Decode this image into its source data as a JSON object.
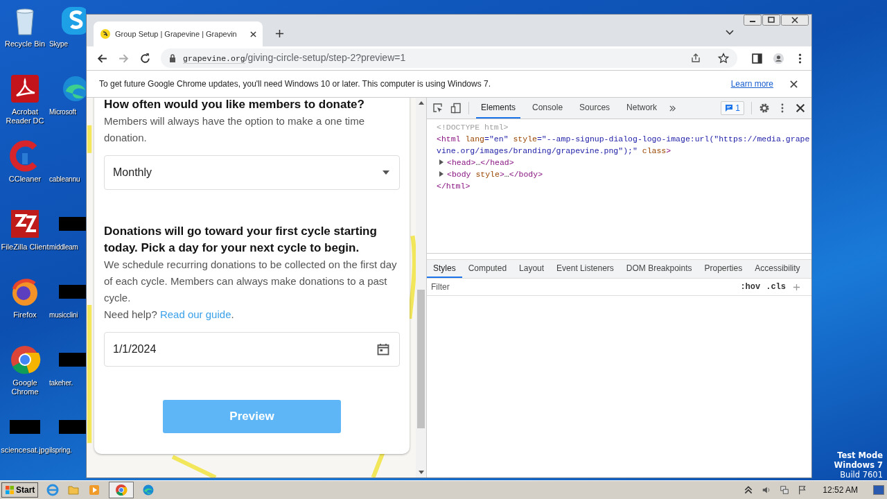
{
  "desktop": {
    "icons": [
      {
        "label": "Recycle Bin",
        "kind": "bin"
      },
      {
        "label": "Skype",
        "kind": "skype"
      },
      {
        "label": "Acrobat Reader DC",
        "kind": "acrobat"
      },
      {
        "label": "Microsoft",
        "kind": "edge"
      },
      {
        "label": "CCleaner",
        "kind": "ccleaner"
      },
      {
        "label": "cableannu",
        "kind": "blank"
      },
      {
        "label": "FileZilla Client",
        "kind": "filezilla"
      },
      {
        "label": "middleam",
        "kind": "file"
      },
      {
        "label": "Firefox",
        "kind": "firefox"
      },
      {
        "label": "musicclini",
        "kind": "file"
      },
      {
        "label": "Google Chrome",
        "kind": "chrome"
      },
      {
        "label": "takeher.",
        "kind": "file"
      },
      {
        "label": "sciencesat.jpg",
        "kind": "file"
      },
      {
        "label": "ilspring.",
        "kind": "file"
      }
    ],
    "os_notice": [
      "Test Mode",
      "Windows 7",
      "Build 7601"
    ]
  },
  "browser": {
    "tab": {
      "title": "Group Setup | Grapevine | Grapevin"
    },
    "address": {
      "domain": "grapevine.org",
      "path": "/giving-circle-setup/step-2?preview=1"
    },
    "infobar": {
      "message": "To get future Google Chrome updates, you'll need Windows 10 or later. This computer is using Windows 7.",
      "link": "Learn more"
    }
  },
  "page": {
    "frequency": {
      "heading": "How often would you like members to donate?",
      "description": "Members will always have the option to make a one time donation.",
      "value": "Monthly"
    },
    "cycle": {
      "heading": "Donations will go toward your first cycle starting today. Pick a day for your next cycle to begin.",
      "description": "We schedule recurring donations to be collected on the first day of each cycle. Members can always make donations to a past cycle.",
      "help": "Need help?",
      "help_link": "Read our guide",
      "help_end": ".",
      "date": "1/1/2024"
    },
    "button": "Preview"
  },
  "devtools": {
    "tabs": [
      {
        "label": "Elements",
        "selected": true
      },
      {
        "label": "Console",
        "selected": false
      },
      {
        "label": "Sources",
        "selected": false
      },
      {
        "label": "Network",
        "selected": false
      }
    ],
    "issues": "1",
    "dom_lines": [
      {
        "expandable": false,
        "tokens": [
          {
            "kind": "doctype",
            "text": "<!DOCTYPE html>"
          }
        ]
      },
      {
        "expandable": false,
        "tokens": [
          {
            "kind": "tag",
            "text": "<html"
          },
          {
            "kind": "attr",
            "text": " lang"
          },
          {
            "kind": "tag",
            "text": "=\"en\""
          },
          {
            "kind": "attr",
            "text": " style"
          },
          {
            "kind": "tag",
            "text": "=\"--amp-signup-dialog-logo-image:url(\"https://media.grapevine.org/images/branding/grapevine.png\");\""
          },
          {
            "kind": "attr",
            "text": " class"
          },
          {
            "kind": "tag",
            "text": ">"
          }
        ]
      },
      {
        "expandable": true,
        "tokens": [
          {
            "kind": "tag",
            "text": "<head>"
          },
          {
            "kind": "plain",
            "text": "…"
          },
          {
            "kind": "tag",
            "text": "</head>"
          }
        ]
      },
      {
        "expandable": true,
        "tokens": [
          {
            "kind": "tag",
            "text": "<body"
          },
          {
            "kind": "attr",
            "text": " style"
          },
          {
            "kind": "tag",
            "text": ">"
          },
          {
            "kind": "plain",
            "text": "…"
          },
          {
            "kind": "tag",
            "text": "</body>"
          }
        ]
      },
      {
        "expandable": false,
        "tokens": [
          {
            "kind": "tag",
            "text": "</html>"
          }
        ]
      }
    ],
    "panel_tabs": [
      {
        "label": "Styles",
        "selected": true
      },
      {
        "label": "Computed",
        "selected": false
      },
      {
        "label": "Layout",
        "selected": false
      },
      {
        "label": "Event Listeners",
        "selected": false
      },
      {
        "label": "DOM Breakpoints",
        "selected": false
      },
      {
        "label": "Properties",
        "selected": false
      },
      {
        "label": "Accessibility",
        "selected": false
      }
    ],
    "filter": {
      "placeholder": "Filter"
    },
    "hov": ":hov",
    "cls": ".cls"
  },
  "taskbar": {
    "start": "Start",
    "time": "12:52 AM"
  }
}
